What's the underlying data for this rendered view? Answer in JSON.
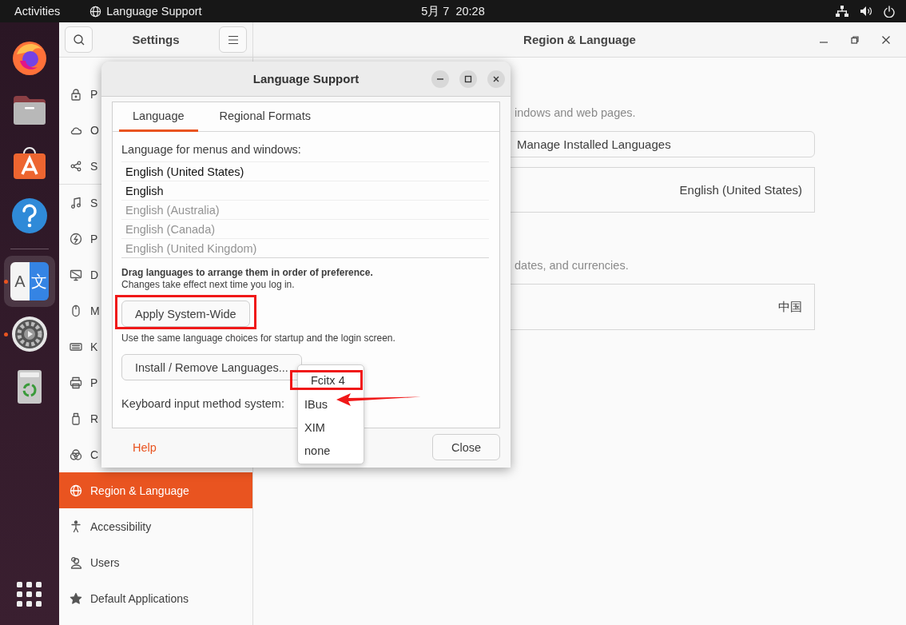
{
  "top_bar": {
    "activities": "Activities",
    "app_name": "Language Support",
    "clock": "5月 7  20:28"
  },
  "dock": {
    "apps": [
      {
        "kind": "firefox",
        "running": false,
        "selected": false
      },
      {
        "kind": "files",
        "running": false,
        "selected": false
      },
      {
        "kind": "store",
        "running": false,
        "selected": false
      },
      {
        "kind": "help",
        "running": false,
        "selected": false
      },
      {
        "kind": "language",
        "running": true,
        "selected": true,
        "glyphs": [
          "A",
          "文"
        ]
      },
      {
        "kind": "settings",
        "running": true,
        "selected": false
      },
      {
        "kind": "trash",
        "running": false,
        "selected": false
      }
    ]
  },
  "settings": {
    "title": "Settings",
    "sidebar": [
      {
        "label": "P",
        "kind": "lock",
        "selected": false,
        "divider_before": false
      },
      {
        "label": "O",
        "kind": "cloud",
        "selected": false,
        "divider_before": false
      },
      {
        "label": "S",
        "kind": "share",
        "selected": false,
        "divider_before": false
      },
      {
        "label": "S",
        "kind": "music",
        "selected": false,
        "divider_before": true
      },
      {
        "label": "P",
        "kind": "power",
        "selected": false,
        "divider_before": false
      },
      {
        "label": "D",
        "kind": "display",
        "selected": false,
        "divider_before": false
      },
      {
        "label": "M",
        "kind": "mouse",
        "selected": false,
        "divider_before": false
      },
      {
        "label": "K",
        "kind": "keyboard",
        "selected": false,
        "divider_before": false
      },
      {
        "label": "P",
        "kind": "printer",
        "selected": false,
        "divider_before": false
      },
      {
        "label": "R",
        "kind": "usb",
        "selected": false,
        "divider_before": false
      },
      {
        "label": "C",
        "kind": "color",
        "selected": false,
        "divider_before": false
      },
      {
        "label": "Region & Language",
        "kind": "globe",
        "selected": true,
        "divider_before": false
      },
      {
        "label": "Accessibility",
        "kind": "accessibility",
        "selected": false,
        "divider_before": false
      },
      {
        "label": "Users",
        "kind": "users",
        "selected": false,
        "divider_before": false
      },
      {
        "label": "Default Applications",
        "kind": "star",
        "selected": false,
        "divider_before": false
      }
    ],
    "page_title": "Region & Language",
    "language_caption": "indows and web pages.",
    "manage_button": "Manage Installed Languages",
    "language_value": "English (United States)",
    "formats_caption": "dates, and currencies.",
    "formats_value": "中国"
  },
  "dialog": {
    "title": "Language Support",
    "tabs": [
      {
        "label": "Language",
        "selected": true
      },
      {
        "label": "Regional Formats",
        "selected": false
      }
    ],
    "list_label": "Language for menus and windows:",
    "languages": [
      {
        "name": "English (United States)",
        "enabled": true
      },
      {
        "name": "English",
        "enabled": true
      },
      {
        "name": "English (Australia)",
        "enabled": false
      },
      {
        "name": "English (Canada)",
        "enabled": false
      },
      {
        "name": "English (United Kingdom)",
        "enabled": false
      }
    ],
    "drag_hint": "Drag languages to arrange them in order of preference.",
    "restart_hint": "Changes take effect next time you log in.",
    "apply_button": {
      "label": "Apply System-Wide",
      "highlighted": true
    },
    "apply_hint": "Use the same language choices for startup and the login screen.",
    "install_button": "Install / Remove Languages...",
    "im_label": "Keyboard input method system:",
    "im_menu": [
      {
        "label": "Fcitx 4",
        "highlighted": true,
        "pointed": false
      },
      {
        "label": "IBus",
        "highlighted": false,
        "pointed": true
      },
      {
        "label": "XIM",
        "highlighted": false,
        "pointed": false
      },
      {
        "label": "none",
        "highlighted": false,
        "pointed": false
      }
    ],
    "help": "Help",
    "close": "Close"
  }
}
